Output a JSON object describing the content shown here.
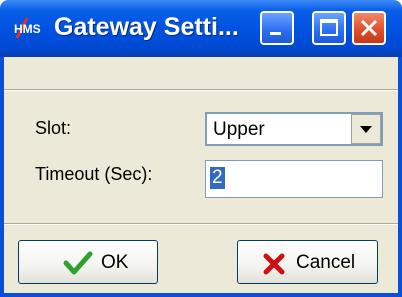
{
  "window": {
    "title": "Gateway Setti...",
    "app_icon": "hms-logo-icon",
    "controls": [
      "minimize-icon",
      "maximize-icon",
      "close-icon"
    ]
  },
  "form": {
    "slot_label": "Slot:",
    "slot_value": "Upper",
    "timeout_label": "Timeout (Sec):",
    "timeout_value": "2"
  },
  "buttons": {
    "ok_label": "OK",
    "cancel_label": "Cancel"
  },
  "colors": {
    "titlebar": "#0053e1",
    "face": "#ece9d8",
    "selection": "#316ac5",
    "ok_check": "#2ea12e",
    "cancel_x": "#d01010"
  }
}
